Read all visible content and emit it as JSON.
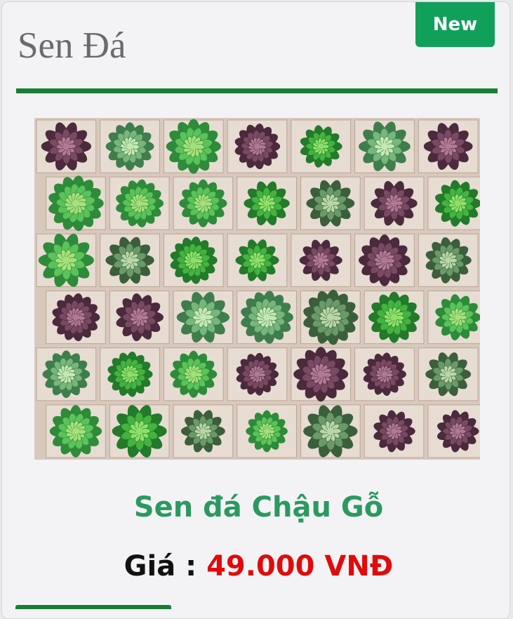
{
  "card": {
    "badge": "New",
    "title": "Sen Đá",
    "image_alt": "Sen đá Chậu Gỗ",
    "product_name": "Sen đá Chậu Gỗ",
    "price_label": "Giá :",
    "price_value": "49.000 VNĐ"
  },
  "colors": {
    "badge": "#11a05a",
    "divider": "#177f34",
    "product_name": "#2b9960",
    "price": "#e00b0b"
  }
}
